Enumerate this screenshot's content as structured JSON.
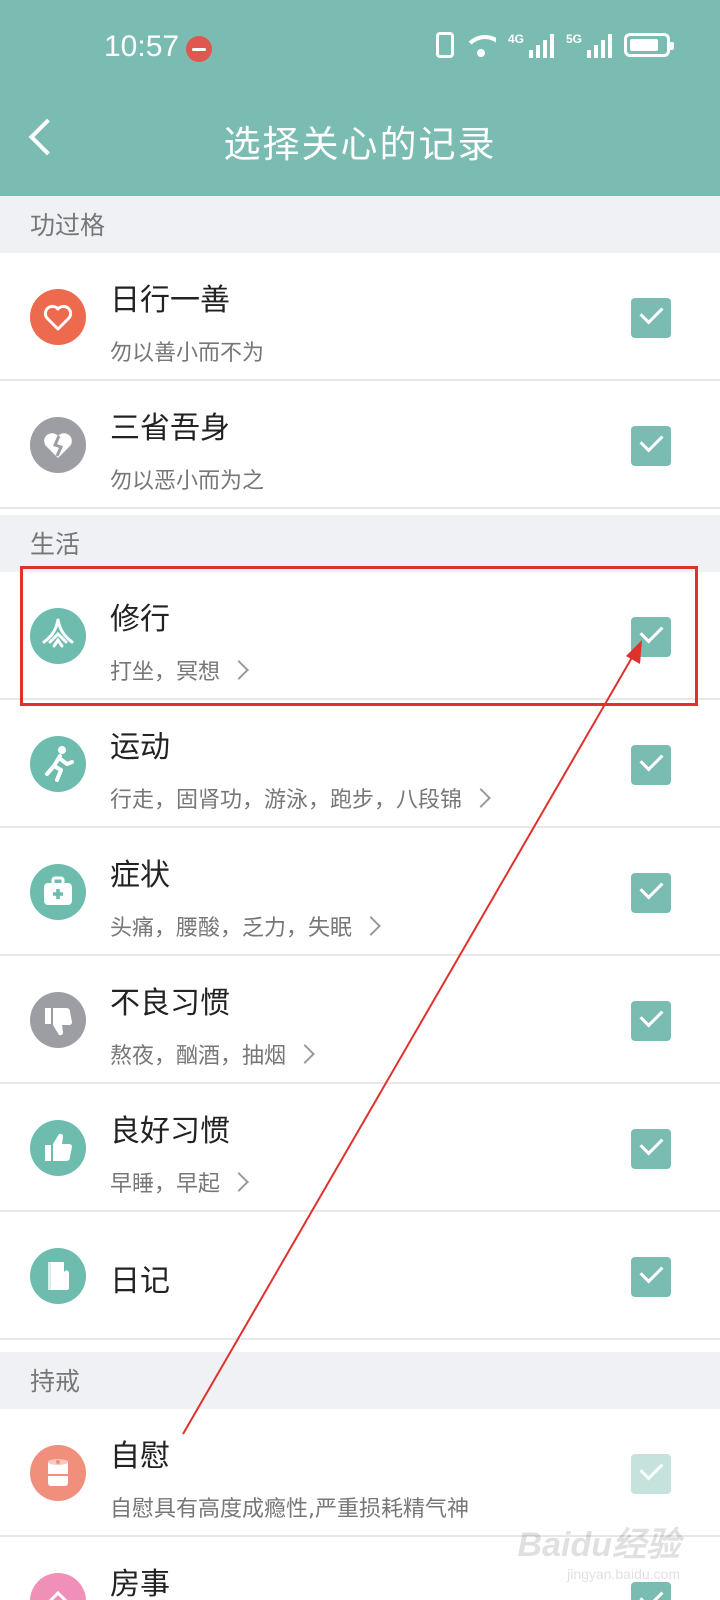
{
  "status_bar": {
    "time": "10:57",
    "net1": "4G",
    "net2": "5G"
  },
  "header": {
    "title": "选择关心的记录"
  },
  "sections": [
    {
      "label": "功过格",
      "rows": [
        {
          "title": "日行一善",
          "subtitle": "勿以善小而不为",
          "icon": "heart-icon",
          "color": "#ee6a4f",
          "checked": true
        },
        {
          "title": "三省吾身",
          "subtitle": "勿以恶小而为之",
          "icon": "broken-heart-icon",
          "color": "#9c9ea3",
          "checked": true
        }
      ]
    },
    {
      "label": "生活",
      "rows": [
        {
          "title": "修行",
          "subtitle": "打坐，冥想",
          "icon": "meditation-icon",
          "color": "#6dbcae",
          "checked": true
        },
        {
          "title": "运动",
          "subtitle": "行走，固肾功，游泳，跑步，八段锦",
          "icon": "running-icon",
          "color": "#6dbcae",
          "checked": true
        },
        {
          "title": "症状",
          "subtitle": "头痛，腰酸，乏力，失眠",
          "icon": "medical-kit-icon",
          "color": "#6dbcae",
          "checked": true
        },
        {
          "title": "不良习惯",
          "subtitle": "熬夜，酗酒，抽烟",
          "icon": "thumbs-down-icon",
          "color": "#9c9ea3",
          "checked": true
        },
        {
          "title": "良好习惯",
          "subtitle": "早睡，早起",
          "icon": "thumbs-up-icon",
          "color": "#6dbcae",
          "checked": true
        },
        {
          "title": "日记",
          "icon": "diary-book-icon",
          "color": "#6dbcae",
          "checked": true
        }
      ]
    },
    {
      "label": "持戒",
      "rows": [
        {
          "title": "自慰",
          "subtitle": "自慰具有高度成瘾性,严重损耗精气神",
          "icon": "tissue-roll-icon",
          "color": "#f08f7c",
          "checked": true
        },
        {
          "title": "房事",
          "icon": "couple-icon",
          "color": "#f08fb8",
          "checked": true
        }
      ]
    }
  ],
  "watermark": {
    "text": "Baidu经验",
    "sub": "jingyan.baidu.com"
  },
  "accent_color": "#7bbcb2",
  "annotation_color": "#e0322c"
}
